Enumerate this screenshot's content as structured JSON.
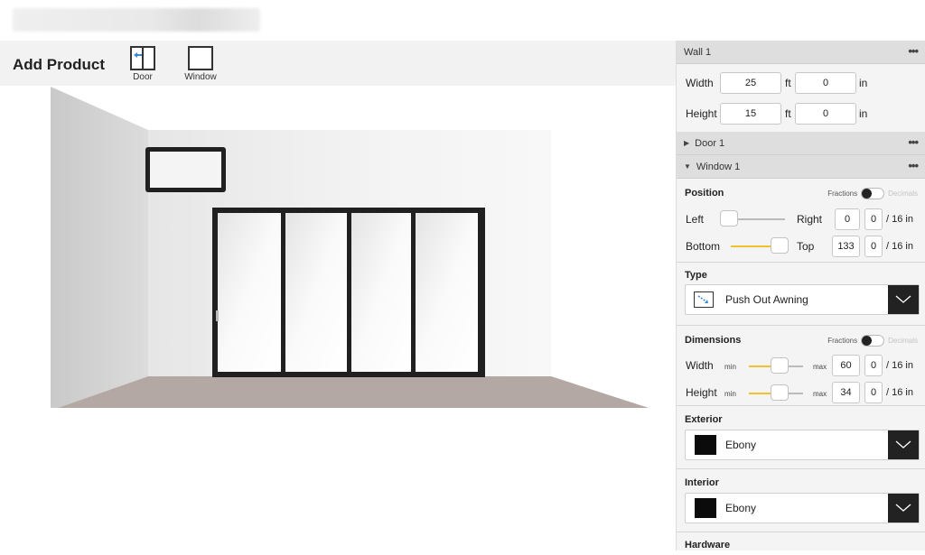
{
  "toolbar": {
    "title": "Add Product",
    "door_label": "Door",
    "window_label": "Window"
  },
  "panel": {
    "wall": {
      "title": "Wall 1",
      "width_label": "Width",
      "width_ft": "25",
      "width_in": "0",
      "height_label": "Height",
      "height_ft": "15",
      "height_in": "0",
      "ft": "ft",
      "in": "in"
    },
    "door": {
      "title": "Door 1"
    },
    "window": {
      "title": "Window 1"
    },
    "position": {
      "title": "Position",
      "fractions": "Fractions",
      "decimals": "Decimals",
      "left_label": "Left",
      "right_label": "Right",
      "right_value": "0",
      "right_frac": "0",
      "bottom_label": "Bottom",
      "top_label": "Top",
      "top_value": "133",
      "top_frac": "0",
      "unit": "/ 16 in"
    },
    "type": {
      "title": "Type",
      "value": "Push Out Awning"
    },
    "dimensions": {
      "title": "Dimensions",
      "fractions": "Fractions",
      "decimals": "Decimals",
      "width_label": "Width",
      "width_value": "60",
      "width_frac": "0",
      "height_label": "Height",
      "height_value": "34",
      "height_frac": "0",
      "min": "min",
      "max": "max",
      "unit": "/ 16 in"
    },
    "exterior": {
      "title": "Exterior",
      "value": "Ebony",
      "color": "#0b0b0b"
    },
    "interior": {
      "title": "Interior",
      "value": "Ebony",
      "color": "#0b0b0b"
    },
    "hardware": {
      "title": "Hardware"
    },
    "more": "•••"
  },
  "colors": {
    "accent": "#f2c12e",
    "dark": "#222222",
    "floor": "#b3a8a4",
    "door_arrow": "#3a86d8"
  }
}
